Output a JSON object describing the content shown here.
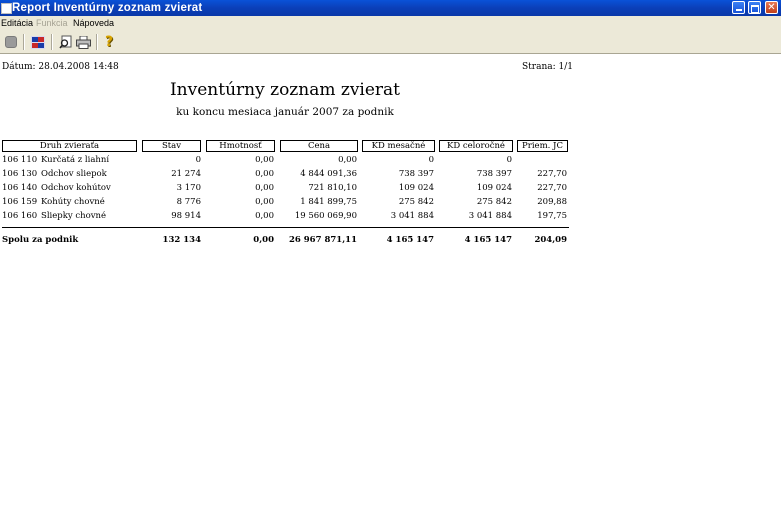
{
  "window": {
    "title": "Report Inventúrny zoznam zvierat"
  },
  "menu": {
    "items": [
      {
        "label": "Editácia",
        "disabled": false
      },
      {
        "label": "Funkcia",
        "disabled": true
      },
      {
        "label": "Nápoveda",
        "disabled": false
      }
    ]
  },
  "toolbar": {
    "icons": [
      "stop-icon",
      "export-icon",
      "print-preview-icon",
      "print-icon",
      "help-icon"
    ]
  },
  "report": {
    "date": "Dátum: 28.04.2008 14:48",
    "page": "Strana: 1/1",
    "title": "Inventúrny zoznam zvierat",
    "subtitle": "ku koncu mesiaca január 2007 za podnik",
    "columns": [
      "Druh zvieraťa",
      "Stav",
      "Hmotnosť",
      "Cena",
      "KD mesačné",
      "KD celoročné",
      "Priem. JC"
    ],
    "rows": [
      {
        "code": "106 110",
        "name": "Kurčatá z liahní",
        "stav": "0",
        "hmotnost": "0,00",
        "cena": "0,00",
        "kd_mes": "0",
        "kd_cel": "0",
        "jc": ""
      },
      {
        "code": "106 130",
        "name": "Odchov sliepok",
        "stav": "21 274",
        "hmotnost": "0,00",
        "cena": "4 844 091,36",
        "kd_mes": "738 397",
        "kd_cel": "738 397",
        "jc": "227,70"
      },
      {
        "code": "106 140",
        "name": "Odchov kohútov",
        "stav": "3 170",
        "hmotnost": "0,00",
        "cena": "721 810,10",
        "kd_mes": "109 024",
        "kd_cel": "109 024",
        "jc": "227,70"
      },
      {
        "code": "106 159",
        "name": "Kohúty chovné",
        "stav": "8 776",
        "hmotnost": "0,00",
        "cena": "1 841 899,75",
        "kd_mes": "275 842",
        "kd_cel": "275 842",
        "jc": "209,88"
      },
      {
        "code": "106 160",
        "name": "Sliepky chovné",
        "stav": "98 914",
        "hmotnost": "0,00",
        "cena": "19 560 069,90",
        "kd_mes": "3 041 884",
        "kd_cel": "3 041 884",
        "jc": "197,75"
      }
    ],
    "total": {
      "label": "Spolu za podnik",
      "stav": "132 134",
      "hmotnost": "0,00",
      "cena": "26 967 871,11",
      "kd_mes": "4 165 147",
      "kd_cel": "4 165 147",
      "jc": "204,09"
    }
  }
}
